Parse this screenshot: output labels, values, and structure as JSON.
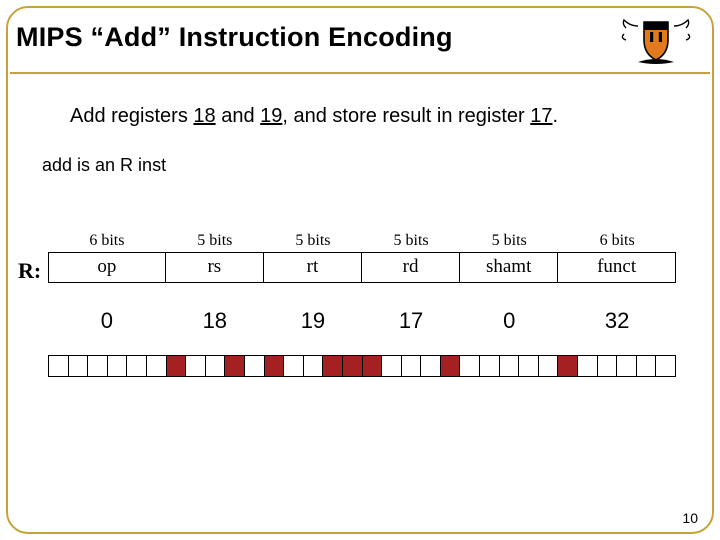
{
  "title": "MIPS “Add” Instruction Encoding",
  "subtitle": {
    "pre": "Add registers ",
    "r1": "18",
    "mid1": " and ",
    "r2": "19",
    "mid2": ", and store result in register ",
    "r3": "17",
    "post": "."
  },
  "note": "add is an R inst",
  "rlabel": "R:",
  "bits_labels": [
    "6 bits",
    "5 bits",
    "5 bits",
    "5 bits",
    "5 bits",
    "6 bits"
  ],
  "field_labels": [
    "op",
    "rs",
    "rt",
    "rd",
    "shamt",
    "funct"
  ],
  "field_values": [
    "0",
    "18",
    "19",
    "17",
    "0",
    "32"
  ],
  "bit_pattern": "00000010010100111000100000100000",
  "page_number": "10",
  "logo": {
    "shield_color": "#e07a1c",
    "shield_stroke": "#000",
    "wing_color": "#000",
    "banner_color": "#000"
  }
}
